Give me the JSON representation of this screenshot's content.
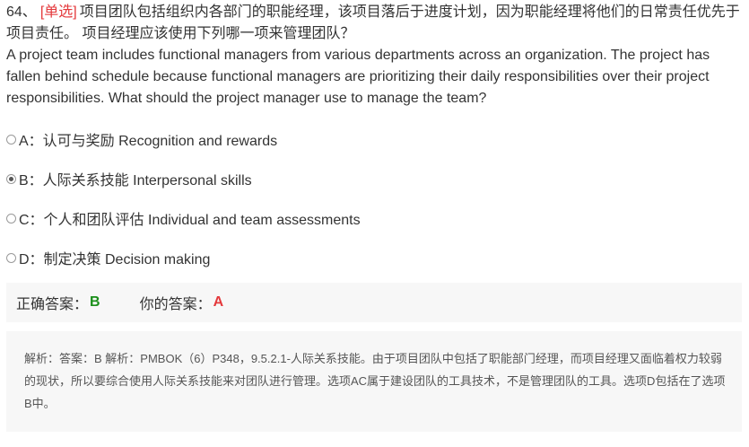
{
  "question": {
    "number": "64、",
    "type_tag": "[单选]",
    "text_cn": "项目团队包括组织内各部门的职能经理，该项目落后于进度计划，因为职能经理将他们的日常责任优先于项目责任。 项目经理应该使用下列哪一项来管理团队？",
    "text_en": "A project team includes functional managers from various departments across an organization. The project has fallen behind schedule because functional managers are prioritizing their daily responsibilities over their project responsibilities. What should the project manager use to manage the team?"
  },
  "options": [
    {
      "label": "A：认可与奖励 Recognition and rewards",
      "selected": false
    },
    {
      "label": "B：人际关系技能 Interpersonal skills",
      "selected": true
    },
    {
      "label": "C：个人和团队评估 Individual and team assessments",
      "selected": false
    },
    {
      "label": "D：制定决策 Decision making",
      "selected": false
    }
  ],
  "answer": {
    "correct_label": "正确答案：",
    "correct_value": "B",
    "yours_label": "你的答案：",
    "yours_value": "A"
  },
  "analysis": {
    "text": "解析：答案：B 解析：PMBOK（6）P348，9.5.2.1-人际关系技能。由于项目团队中包括了职能部门经理，而项目经理又面临着权力较弱的现状，所以要综合使用人际关系技能来对团队进行管理。选项AC属于建设团队的工具技术，不是管理团队的工具。选项D包括在了选项B中。"
  },
  "colors": {
    "type_tag": "#e4393c",
    "correct": "#1a8f1a",
    "yours": "#e4393c",
    "panel_bg": "#f7f7f7"
  }
}
